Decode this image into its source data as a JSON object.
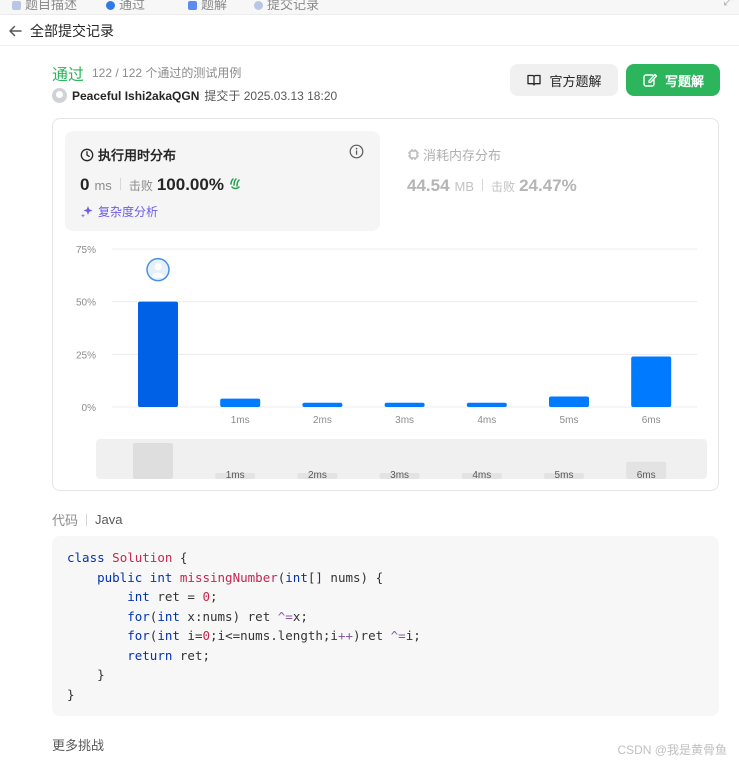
{
  "top_tabs": [
    {
      "label": "题目描述",
      "icon_color": "#b8c7e6"
    },
    {
      "label": "通过",
      "icon_color": "#2e7be6"
    },
    {
      "label": "题解",
      "icon_color": "#5b8def"
    },
    {
      "label": "提交记录",
      "icon_color": "#b8c7e6"
    }
  ],
  "nav": {
    "back_label": "全部提交记录"
  },
  "submission": {
    "status": "通过",
    "testcases": "122 / 122 个通过的测试用例",
    "author": "Peaceful Ishi2akaQGN",
    "submitted_at": "提交于 2025.03.13 18:20"
  },
  "buttons": {
    "official": "官方题解",
    "write": "写题解"
  },
  "runtime": {
    "title": "执行用时分布",
    "value": "0",
    "unit": "ms",
    "beat_label": "击败",
    "beat_value": "100.00%",
    "complexity_label": "复杂度分析"
  },
  "memory": {
    "title": "消耗内存分布",
    "value": "44.54",
    "unit": "MB",
    "beat_label": "击败",
    "beat_value": "24.47%"
  },
  "chart_data": {
    "type": "bar",
    "categories": [
      "",
      "1ms",
      "2ms",
      "3ms",
      "4ms",
      "5ms",
      "6ms"
    ],
    "values": [
      50,
      4,
      2,
      2,
      2,
      5,
      24
    ],
    "yticks": [
      "0%",
      "25%",
      "50%",
      "75%"
    ],
    "ylim": [
      0,
      75
    ],
    "highlight_index": 0,
    "colors": {
      "highlight": "#0060e6",
      "bar": "#007aff"
    }
  },
  "code": {
    "label": "代码",
    "language": "Java"
  },
  "more_label": "更多挑战",
  "watermark": "CSDN @我是黄骨鱼"
}
